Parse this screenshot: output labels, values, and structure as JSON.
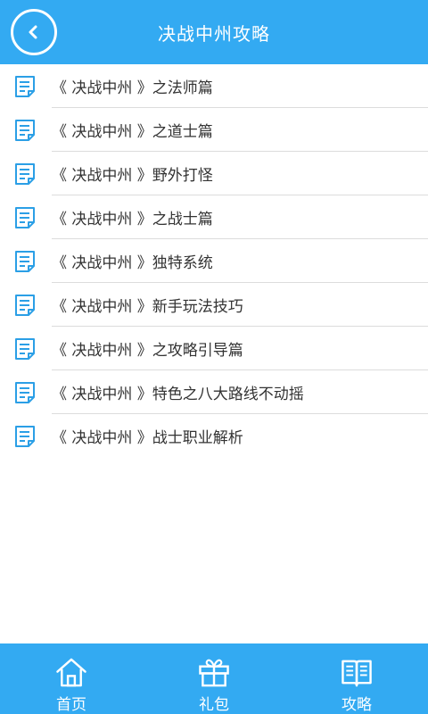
{
  "header": {
    "title": "决战中州攻略",
    "back_icon": "chevron-left-icon"
  },
  "list": {
    "icon": "document-icon",
    "items": [
      {
        "label": "《 决战中州 》之法师篇"
      },
      {
        "label": "《 决战中州 》之道士篇"
      },
      {
        "label": "《 决战中州 》野外打怪"
      },
      {
        "label": "《 决战中州 》之战士篇"
      },
      {
        "label": "《 决战中州 》独特系统"
      },
      {
        "label": "《 决战中州 》新手玩法技巧"
      },
      {
        "label": "《 决战中州 》之攻略引导篇"
      },
      {
        "label": "《 决战中州 》特色之八大路线不动摇"
      },
      {
        "label": "《 决战中州 》战士职业解析"
      }
    ]
  },
  "tabbar": {
    "tabs": [
      {
        "label": "首页",
        "icon": "home-icon"
      },
      {
        "label": "礼包",
        "icon": "gift-icon"
      },
      {
        "label": "攻略",
        "icon": "book-icon"
      }
    ]
  },
  "colors": {
    "primary": "#33aaf2",
    "icon_blue": "#2b9fe6",
    "text": "#333333",
    "divider": "#dcdcdc"
  }
}
